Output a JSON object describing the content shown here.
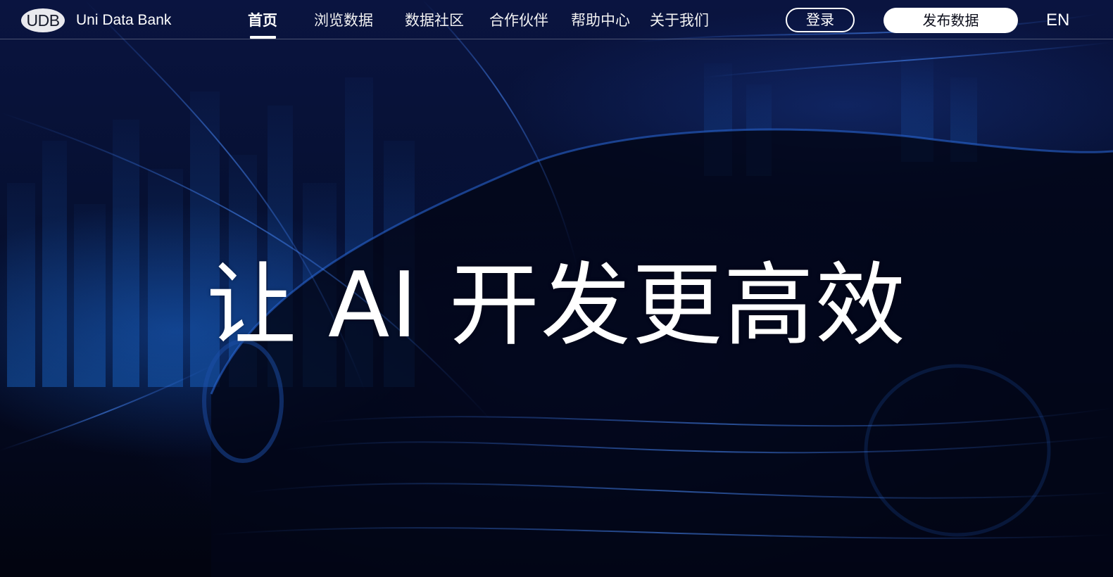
{
  "brand": {
    "logo_text": "UDB",
    "name": "Uni Data Bank"
  },
  "nav": {
    "items": [
      {
        "label": "首页",
        "active": true
      },
      {
        "label": "浏览数据",
        "active": false
      },
      {
        "label": "数据社区",
        "active": false
      },
      {
        "label": "合作伙伴",
        "active": false
      },
      {
        "label": "帮助中心",
        "active": false
      },
      {
        "label": "关于我们",
        "active": false
      }
    ]
  },
  "actions": {
    "login_label": "登录",
    "publish_label": "发布数据",
    "language_label": "EN"
  },
  "hero": {
    "title": "让 AI 开发更高效"
  },
  "colors": {
    "background": "#02040f",
    "hero_blue": "#1450aa",
    "text": "#ffffff",
    "publish_button_bg": "#ffffff",
    "logo_badge_bg": "#e9e9ee"
  }
}
